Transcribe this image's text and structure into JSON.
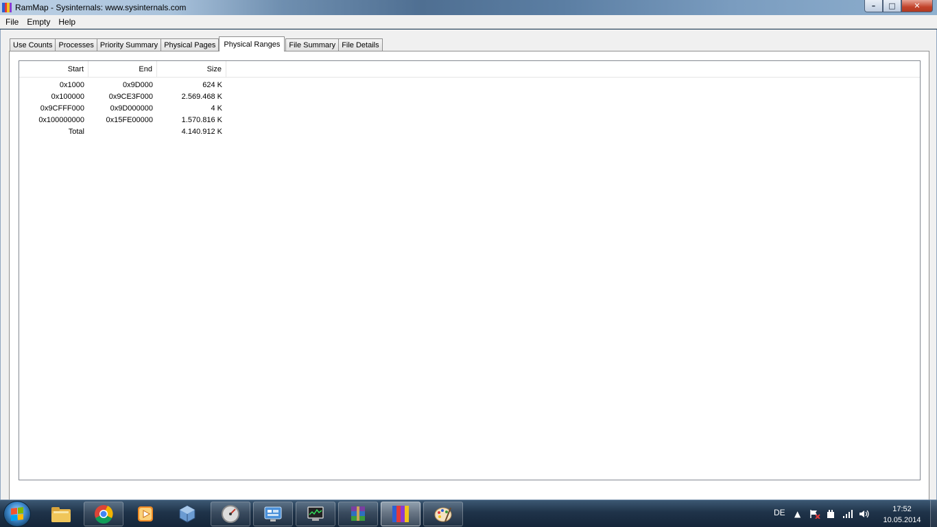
{
  "window": {
    "title": "RamMap - Sysinternals: www.sysinternals.com",
    "controls": {
      "minimize": "–",
      "maximize": "□",
      "close": "✕"
    }
  },
  "menu": [
    "File",
    "Empty",
    "Help"
  ],
  "tabs": [
    {
      "label": "Use Counts",
      "active": false
    },
    {
      "label": "Processes",
      "active": false
    },
    {
      "label": "Priority Summary",
      "active": false
    },
    {
      "label": "Physical Pages",
      "active": false
    },
    {
      "label": "Physical Ranges",
      "active": true
    },
    {
      "label": "File Summary",
      "active": false
    },
    {
      "label": "File Details",
      "active": false
    }
  ],
  "table": {
    "columns": [
      "Start",
      "End",
      "Size"
    ],
    "rows": [
      [
        "0x1000",
        "0x9D000",
        "624 K"
      ],
      [
        "0x100000",
        "0x9CE3F000",
        "2.569.468 K"
      ],
      [
        "0x9CFFF000",
        "0x9D000000",
        "4 K"
      ],
      [
        "0x100000000",
        "0x15FE00000",
        "1.570.816 K"
      ],
      [
        "Total",
        "",
        "4.140.912 K"
      ]
    ]
  },
  "taskbar": {
    "apps": [
      {
        "name": "explorer-icon",
        "active": false
      },
      {
        "name": "chrome-icon",
        "active": false
      },
      {
        "name": "media-player-icon",
        "active": false
      },
      {
        "name": "virtualbox-icon",
        "active": false
      },
      {
        "name": "gauge-app-icon",
        "active": false
      },
      {
        "name": "control-panel-icon",
        "active": false
      },
      {
        "name": "task-manager-icon",
        "active": false
      },
      {
        "name": "winrar-icon",
        "active": false
      },
      {
        "name": "rammap-icon",
        "active": true
      },
      {
        "name": "paint-icon",
        "active": false
      }
    ],
    "tray": {
      "language": "DE",
      "time": "17:52",
      "date": "10.05.2014"
    }
  },
  "colors": {
    "window_bg": "#f0f0f0",
    "taskbar": "#1f3349",
    "close_button": "#c2432b"
  }
}
